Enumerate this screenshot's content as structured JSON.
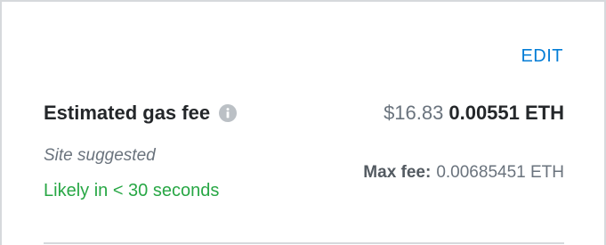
{
  "edit_label": "EDIT",
  "gas": {
    "label": "Estimated gas fee",
    "fiat_amount": "$16.83",
    "eth_amount": "0.00551 ETH",
    "info_icon": "info-icon"
  },
  "suggestion": {
    "source": "Site suggested",
    "timing": "Likely in < 30 seconds"
  },
  "max_fee": {
    "label": "Max fee:",
    "value": "0.00685451 ETH"
  },
  "colors": {
    "link": "#037dd6",
    "success": "#28a745",
    "text_primary": "#24272a",
    "text_muted": "#6a737d",
    "border": "#d6d9dc"
  }
}
